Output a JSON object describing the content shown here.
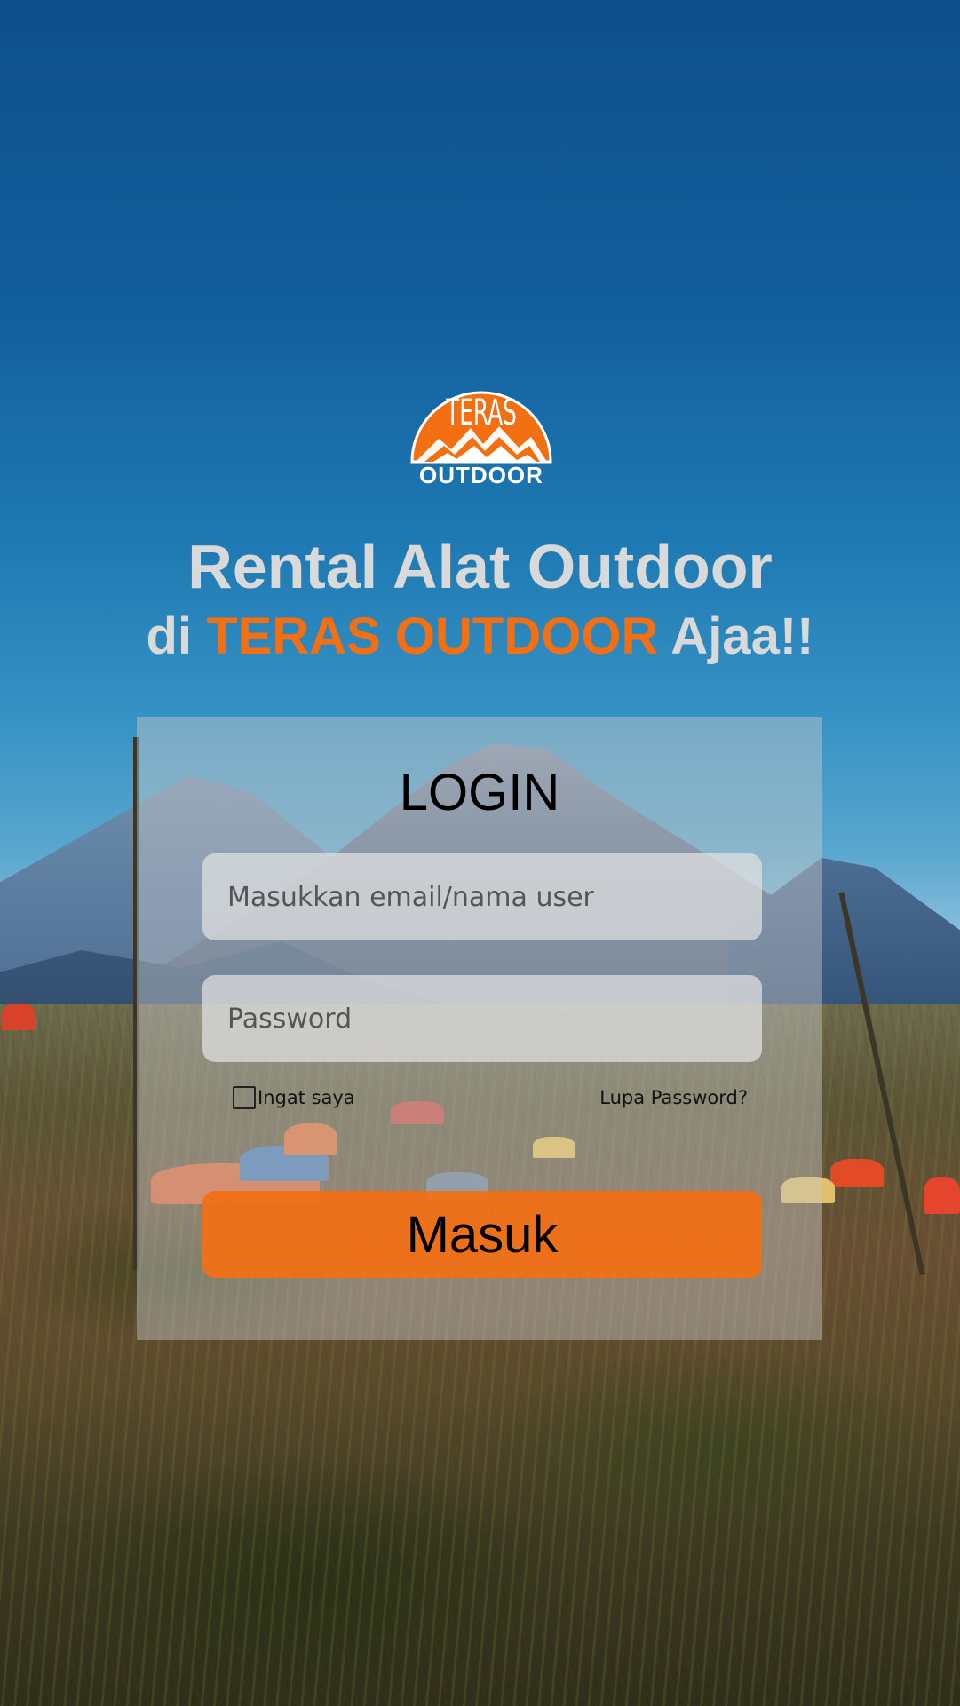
{
  "brand": {
    "logo_top_text": "TERAS",
    "logo_bottom_text": "OUTDOOR",
    "accent_color": "#f36f12"
  },
  "headline": {
    "line1": "Rental Alat Outdoor",
    "line2_prefix": "di ",
    "line2_brand": "TERAS OUTDOOR",
    "line2_suffix": " Ajaa!!"
  },
  "login": {
    "title": "LOGIN",
    "email_placeholder": "Masukkan email/nama user",
    "password_placeholder": "Password",
    "remember_label": "Ingat saya",
    "remember_checked": false,
    "forgot_label": "Lupa Password?",
    "submit_label": "Masuk"
  }
}
